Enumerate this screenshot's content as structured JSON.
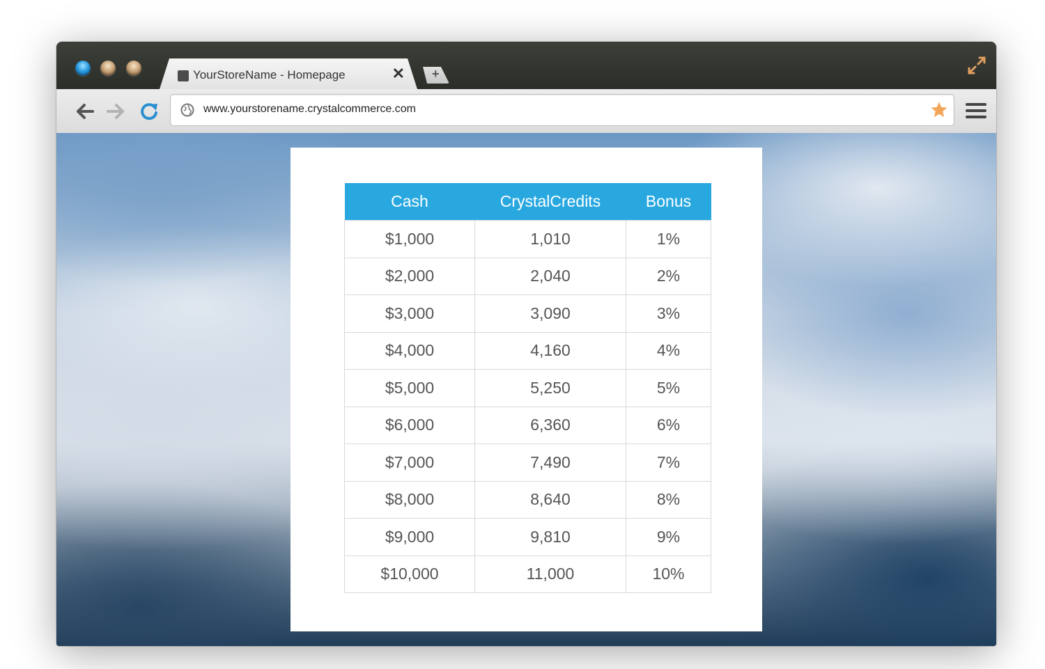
{
  "browser": {
    "window_controls": [
      "close",
      "minimize",
      "maximize"
    ],
    "tab": {
      "title": "YourStoreName - Homepage",
      "close_glyph": "✕"
    },
    "new_tab_glyph": "+",
    "address_bar": {
      "url": "www.yourstorename.crystalcommerce.com"
    },
    "icons": [
      "back-arrow-icon",
      "forward-arrow-icon",
      "reload-icon",
      "globe-icon",
      "bookmark-star-icon",
      "menu-icon",
      "fullscreen-icon"
    ],
    "colors": {
      "accent_blue": "#29a8e0",
      "star_orange": "#f2a65a",
      "reload_blue": "#2a8fd0"
    }
  },
  "table": {
    "headers": [
      "Cash",
      "CrystalCredits",
      "Bonus"
    ],
    "rows": [
      [
        "$1,000",
        "1,010",
        "1%"
      ],
      [
        "$2,000",
        "2,040",
        "2%"
      ],
      [
        "$3,000",
        "3,090",
        "3%"
      ],
      [
        "$4,000",
        "4,160",
        "4%"
      ],
      [
        "$5,000",
        "5,250",
        "5%"
      ],
      [
        "$6,000",
        "6,360",
        "6%"
      ],
      [
        "$7,000",
        "7,490",
        "7%"
      ],
      [
        "$8,000",
        "8,640",
        "8%"
      ],
      [
        "$9,000",
        "9,810",
        "9%"
      ],
      [
        "$10,000",
        "11,000",
        "10%"
      ]
    ]
  }
}
